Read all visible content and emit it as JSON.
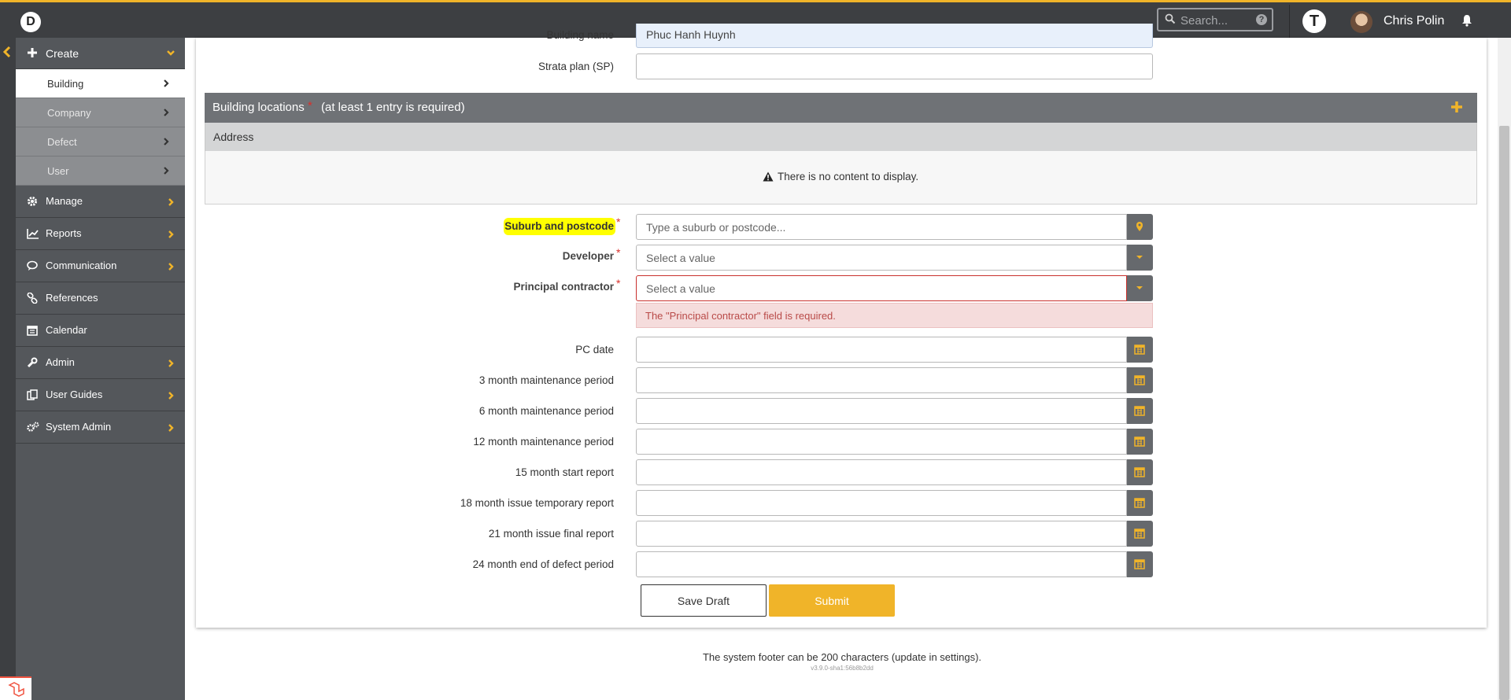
{
  "header": {
    "logo_letter": "D",
    "search_placeholder": "Search...",
    "help_glyph": "?",
    "user_initial": "T",
    "user_name": "Chris Polin"
  },
  "sidebar": {
    "create_label": "Create",
    "create_items": [
      {
        "label": "Building",
        "active": true
      },
      {
        "label": "Company"
      },
      {
        "label": "Defect"
      },
      {
        "label": "User"
      }
    ],
    "items": [
      {
        "label": "Manage",
        "icon": "gear-icon",
        "has_children": true
      },
      {
        "label": "Reports",
        "icon": "chart-line-icon",
        "has_children": true
      },
      {
        "label": "Communication",
        "icon": "chat-icon",
        "has_children": true
      },
      {
        "label": "References",
        "icon": "link-icon",
        "has_children": false
      },
      {
        "label": "Calendar",
        "icon": "calendar-icon",
        "has_children": false
      },
      {
        "label": "Admin",
        "icon": "wrench-icon",
        "has_children": true
      },
      {
        "label": "User Guides",
        "icon": "guide-icon",
        "has_children": true
      },
      {
        "label": "System Admin",
        "icon": "gears-icon",
        "has_children": true
      }
    ]
  },
  "form": {
    "building_name_label": "Building name",
    "building_name_value": "Phuc Hanh Huynh",
    "strata_plan_label": "Strata plan (SP)",
    "locations": {
      "title": "Building locations",
      "note": "(at least 1 entry is required)",
      "column_address": "Address",
      "empty_message": "There is no content to display."
    },
    "suburb_label": "Suburb and postcode",
    "suburb_placeholder": "Type a suburb or postcode...",
    "developer_label": "Developer",
    "developer_placeholder": "Select a value",
    "principal_label": "Principal contractor",
    "principal_placeholder": "Select a value",
    "principal_error": "The \"Principal contractor\" field is required.",
    "date_fields": [
      "PC date",
      "3 month maintenance period",
      "6 month maintenance period",
      "12 month maintenance period",
      "15 month start report",
      "18 month issue temporary report",
      "21 month issue final report",
      "24 month end of defect period"
    ],
    "save_draft_label": "Save Draft",
    "submit_label": "Submit"
  },
  "footer": {
    "text": "The system footer can be 200 characters (update in settings).",
    "version": "v3.9.0-sha1:56b8b2dd"
  },
  "colors": {
    "accent": "#f0b429",
    "topbar": "#3d3f42",
    "sidebar": "#54575b",
    "error_bg": "#f5dcdc",
    "error_text": "#b94a48",
    "highlight": "#ffff00"
  }
}
